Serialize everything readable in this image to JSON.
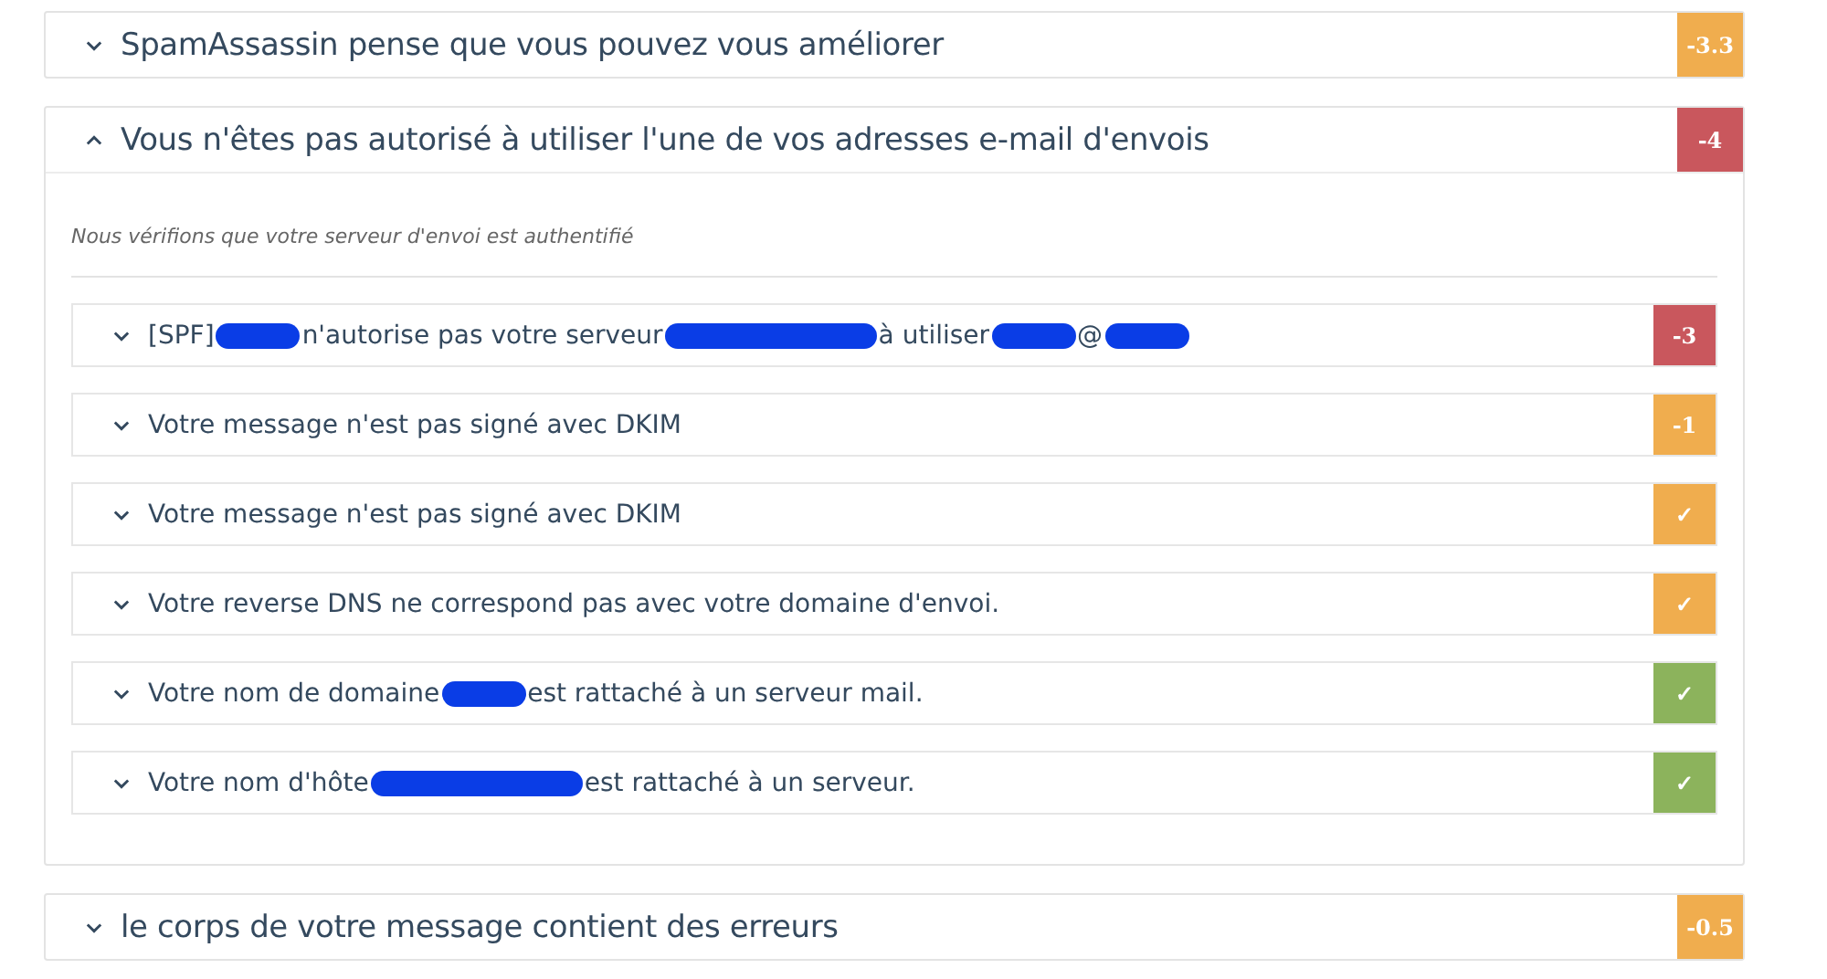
{
  "sections": [
    {
      "title": "SpamAssassin pense que vous pouvez vous améliorer",
      "expanded": false,
      "badge": "-3.3",
      "color": "#f0ad4e"
    },
    {
      "title": "Vous n'êtes pas autorisé à utiliser l'une de vos adresses e-mail d'envois",
      "expanded": true,
      "badge": "-4",
      "color": "#c9575d",
      "note": "Nous vérifions que votre serveur d'envoi est authentifié",
      "checks": [
        {
          "expanded": false,
          "badge": "-3",
          "color": "#c9575d",
          "parts": [
            {
              "kind": "text",
              "text": "[SPF]"
            },
            {
              "kind": "redaction"
            },
            {
              "kind": "text",
              "text": "n'autorise pas votre serveur"
            },
            {
              "kind": "longredaction"
            },
            {
              "kind": "text",
              "text": "à utiliser"
            },
            {
              "kind": "redaction"
            },
            {
              "kind": "text",
              "text": "@"
            },
            {
              "kind": "redaction"
            }
          ]
        },
        {
          "expanded": false,
          "badge": "-1",
          "color": "#f0ad4e",
          "parts": [
            {
              "kind": "text",
              "text": "Votre message n'est pas signé avec DKIM"
            }
          ]
        },
        {
          "expanded": false,
          "badge": "✓",
          "color": "#f0ad4e",
          "parts": [
            {
              "kind": "text",
              "text": "Votre message n'est pas signé avec DKIM"
            }
          ]
        },
        {
          "expanded": false,
          "badge": "✓",
          "color": "#f0ad4e",
          "parts": [
            {
              "kind": "text",
              "text": "Votre reverse DNS ne correspond pas avec votre domaine d'envoi."
            }
          ]
        },
        {
          "expanded": false,
          "badge": "✓",
          "color": "#8cb35c",
          "parts": [
            {
              "kind": "text",
              "text": "Votre nom de domaine"
            },
            {
              "kind": "redaction"
            },
            {
              "kind": "text",
              "text": "est rattaché à un serveur mail."
            }
          ]
        },
        {
          "expanded": false,
          "badge": "✓",
          "color": "#8cb35c",
          "parts": [
            {
              "kind": "text",
              "text": "Votre nom d'hôte"
            },
            {
              "kind": "longredaction"
            },
            {
              "kind": "text",
              "text": "est rattaché à un serveur."
            }
          ]
        }
      ]
    },
    {
      "title": "le corps de votre message contient des erreurs",
      "expanded": false,
      "badge": "-0.5",
      "color": "#f0ad4e"
    }
  ]
}
